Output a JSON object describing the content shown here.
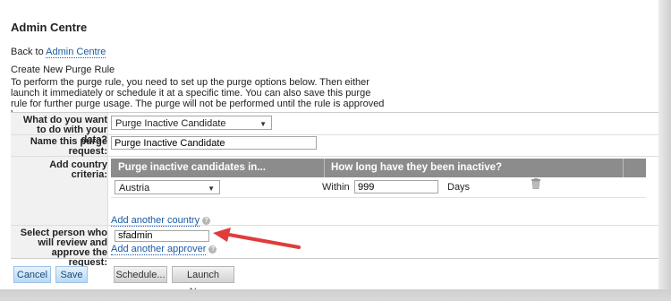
{
  "header": {
    "title": "Admin Centre"
  },
  "nav": {
    "back_prefix": "Back to ",
    "back_link": "Admin Centre"
  },
  "page": {
    "subtitle": "Create New Purge Rule",
    "description": "To perform the purge rule, you need to set up the purge options below. Then either launch it immediately or schedule it at a specific time. You can also save this purge rule for further purge usage. The purge will not be performed until the rule is approved by approvers."
  },
  "form": {
    "data_label": "What do you want to do with your data?",
    "data_selected": "Purge Inactive Candidate",
    "name_label": "Name this purge request:",
    "name_value": "Purge Inactive Candidate",
    "country_label": "Add country criteria:",
    "country_table": {
      "col1": "Purge inactive candidates in...",
      "col2": "How long have they been inactive?",
      "row": {
        "country": "Austria",
        "within_label": "Within",
        "days_value": "999",
        "days_label": "Days"
      }
    },
    "add_country": "Add another country",
    "approver_label": "Select person who will review and approve the request:",
    "approver_value": "sfadmin",
    "add_approver": "Add another approver"
  },
  "buttons": {
    "cancel": "Cancel",
    "save": "Save",
    "schedule": "Schedule...",
    "launch": "Launch Now..."
  },
  "annotation": {
    "arrow_color": "#e03c3c"
  }
}
